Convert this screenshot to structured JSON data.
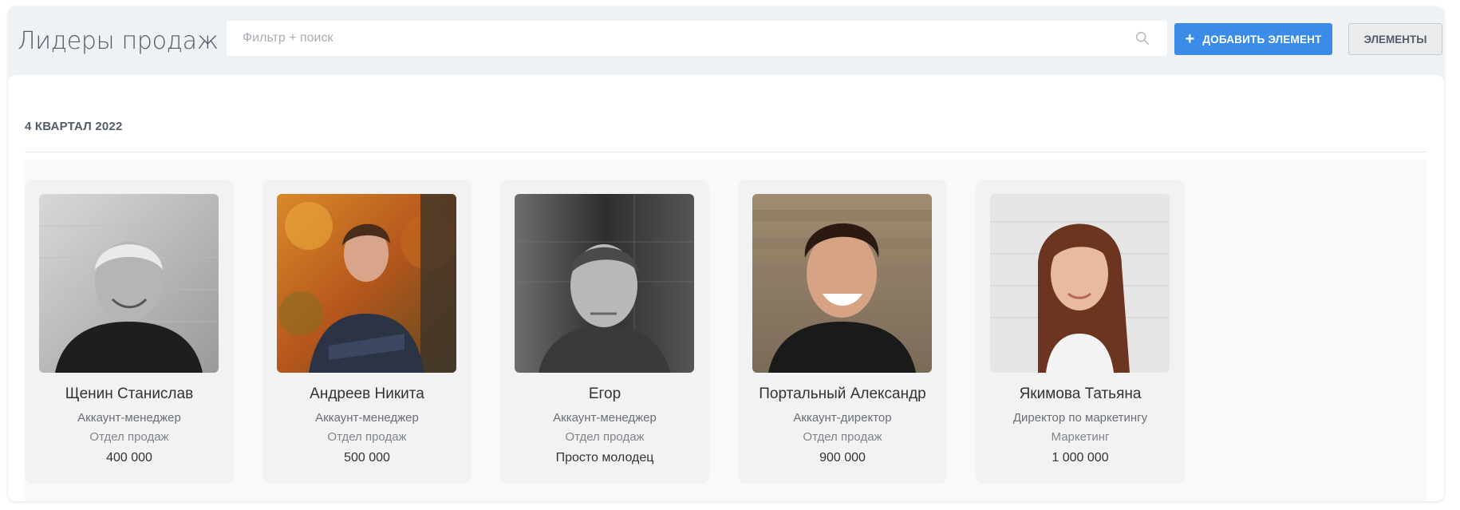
{
  "header": {
    "title": "Лидеры продаж",
    "search_placeholder": "Фильтр + поиск",
    "add_button_label": "ДОБАВИТЬ ЭЛЕМЕНТ",
    "elements_button_label": "ЭЛЕМЕНТЫ"
  },
  "section": {
    "title": "4 КВАРТАЛ 2022"
  },
  "cards": [
    {
      "name": "Щенин Станислав",
      "position": "Аккаунт-менеджер",
      "department": "Отдел продаж",
      "value": "400 000"
    },
    {
      "name": "Андреев Никита",
      "position": "Аккаунт-менеджер",
      "department": "Отдел продаж",
      "value": "500 000"
    },
    {
      "name": "Егор",
      "position": "Аккаунт-менеджер",
      "department": "Отдел продаж",
      "value": "Просто молодец"
    },
    {
      "name": "Портальный Александр",
      "position": "Аккаунт-директор",
      "department": "Отдел продаж",
      "value": "900 000"
    },
    {
      "name": "Якимова Татьяна",
      "position": "Директор по маркетингу",
      "department": "Маркетинг",
      "value": "1 000 000"
    }
  ],
  "colors": {
    "accent": "#3b8ce8",
    "background": "#eef2f4",
    "card": "#f2f2f2"
  },
  "icons": [
    "star-icon",
    "search-icon",
    "plus-icon"
  ]
}
